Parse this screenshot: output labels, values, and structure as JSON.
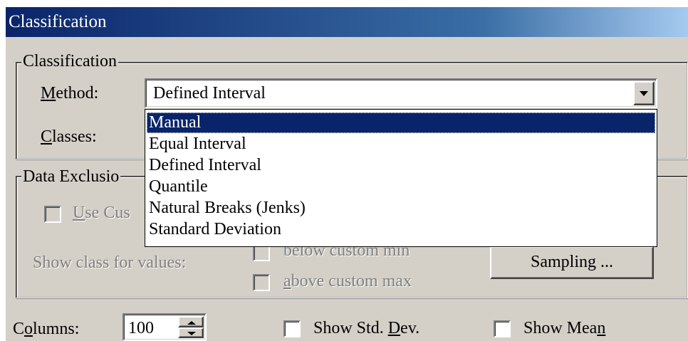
{
  "window": {
    "title": "Classification"
  },
  "classification_group": {
    "legend": "Classification",
    "method_label_prefix": "",
    "method_label_accel": "M",
    "method_label_rest": "ethod:",
    "method_value": "Defined Interval",
    "classes_label_accel": "C",
    "classes_label_rest": "lasses:"
  },
  "method_dropdown": {
    "options": [
      {
        "label": "Manual",
        "selected": true
      },
      {
        "label": "Equal Interval",
        "selected": false
      },
      {
        "label": "Defined Interval",
        "selected": false
      },
      {
        "label": "Quantile",
        "selected": false
      },
      {
        "label": "Natural Breaks (Jenks)",
        "selected": false
      },
      {
        "label": "Standard Deviation",
        "selected": false
      }
    ]
  },
  "data_exclusion_group": {
    "legend": "Data Exclusio",
    "use_custom_accel": "U",
    "use_custom_rest": "se Cus",
    "show_class_label": "Show class for values:",
    "below_custom_min": "below custom min",
    "above_accel": "a",
    "above_rest": "bove custom max",
    "sampling_button": "Sampling ..."
  },
  "footer": {
    "columns_label_pre": "C",
    "columns_label_accel": "o",
    "columns_label_rest": "lumns:",
    "columns_value": "100",
    "show_std_dev_pre": "Show Std. ",
    "show_std_dev_accel": "D",
    "show_std_dev_rest": "ev.",
    "show_mean_pre": "Show Mea",
    "show_mean_accel": "n"
  },
  "colors": {
    "titlebar_start": "#0a246a",
    "titlebar_end": "#a6caf0",
    "face": "#d4d0c8",
    "selection": "#0a246a"
  }
}
